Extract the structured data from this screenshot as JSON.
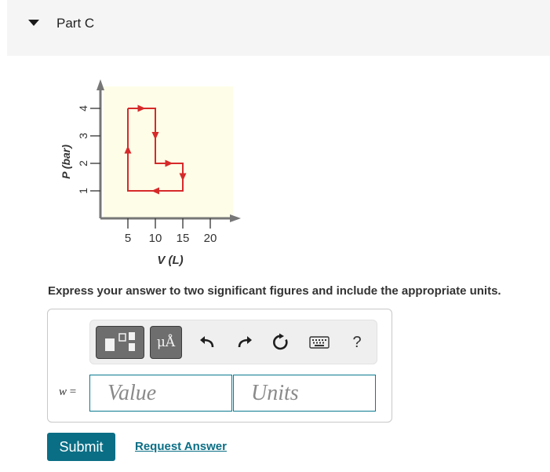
{
  "part": {
    "title": "Part C"
  },
  "chart_data": {
    "type": "line",
    "title": "",
    "xlabel": "V (L)",
    "ylabel": "P (bar)",
    "xticks": [
      5,
      10,
      15,
      20
    ],
    "yticks": [
      1,
      2,
      3,
      4
    ],
    "xlim": [
      0,
      25
    ],
    "ylim": [
      0,
      5
    ],
    "series": [
      {
        "x": [
          5,
          10,
          10,
          15,
          15,
          5,
          5
        ],
        "y": [
          4,
          4,
          2,
          2,
          1,
          1,
          4
        ]
      }
    ],
    "colors": {
      "cycle": "#d62a2a",
      "plot_background": "#fefde8",
      "axes": "#777777"
    }
  },
  "instruction": "Express your answer to two significant figures and include the appropriate units.",
  "toolbar": {
    "units_button_label": "μÅ",
    "help_label": "?",
    "icons": [
      "template-icon",
      "undo-icon",
      "redo-icon",
      "reset-icon",
      "keyboard-icon"
    ]
  },
  "answer": {
    "variable": "w",
    "equals": "=",
    "value_placeholder": "Value",
    "units_placeholder": "Units"
  },
  "actions": {
    "submit_label": "Submit",
    "request_label": "Request Answer"
  },
  "colors": {
    "accent": "#0a6e85",
    "input_border": "#0a7a8f"
  }
}
